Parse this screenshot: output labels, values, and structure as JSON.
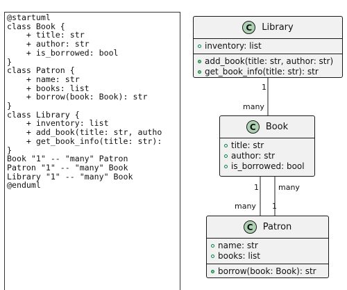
{
  "code": {
    "lines": [
      "@startuml",
      "class Book {",
      "    + title: str",
      "    + author: str",
      "    + is_borrowed: bool",
      "}",
      "class Patron {",
      "    + name: str",
      "    + books: list",
      "    + borrow(book: Book): str",
      "}",
      "class Library {",
      "    + inventory: list",
      "    + add_book(title: str, autho",
      "    + get_book_info(title: str):",
      "}",
      "Book \"1\" -- \"many\" Patron",
      "Patron \"1\" -- \"many\" Book",
      "Library \"1\" -- \"many\" Book",
      "@enduml"
    ]
  },
  "diagram": {
    "library": {
      "icon": "C",
      "name": "Library",
      "attributes": [
        "inventory: list"
      ],
      "methods": [
        "add_book(title: str, author: str)",
        "get_book_info(title: str): str"
      ]
    },
    "book": {
      "icon": "C",
      "name": "Book",
      "attributes": [
        "title: str",
        "author: str",
        "is_borrowed: bool"
      ],
      "methods": []
    },
    "patron": {
      "icon": "C",
      "name": "Patron",
      "attributes": [
        "name: str",
        "books: list"
      ],
      "methods": [
        "borrow(book: Book): str"
      ]
    },
    "associations": {
      "library_book": {
        "source": "1",
        "target": "many"
      },
      "book_patron": {
        "source": "1",
        "target": "many"
      },
      "patron_book": {
        "source": "1",
        "target": "many"
      }
    }
  },
  "colors": {
    "class_fill": "#f1f1f1",
    "icon_fill": "#add1b2",
    "line": "#181818",
    "visibility": "#038048"
  }
}
